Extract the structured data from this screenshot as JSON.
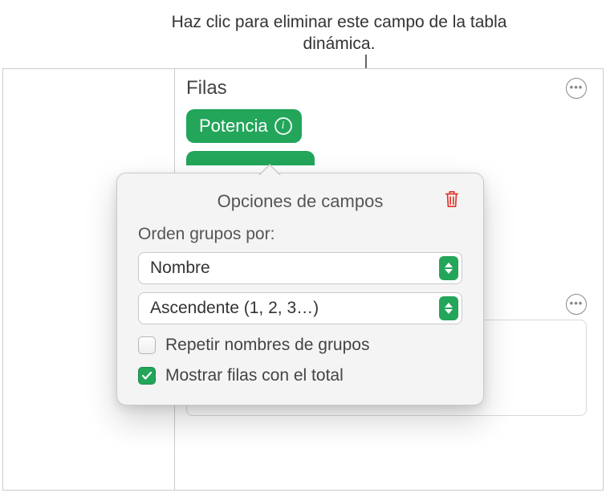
{
  "callout": {
    "text": "Haz clic para eliminar este campo de la tabla dinámica."
  },
  "rows_section": {
    "title": "Filas",
    "pill_label": "Potencia"
  },
  "popover": {
    "title": "Opciones de campos",
    "order_label": "Orden grupos por:",
    "sort_by": "Nombre",
    "sort_direction": "Ascendente (1, 2, 3…)",
    "repeat_label": "Repetir nombres de grupos",
    "show_totals_label": "Mostrar filas con el total",
    "repeat_checked": false,
    "show_totals_checked": true
  }
}
